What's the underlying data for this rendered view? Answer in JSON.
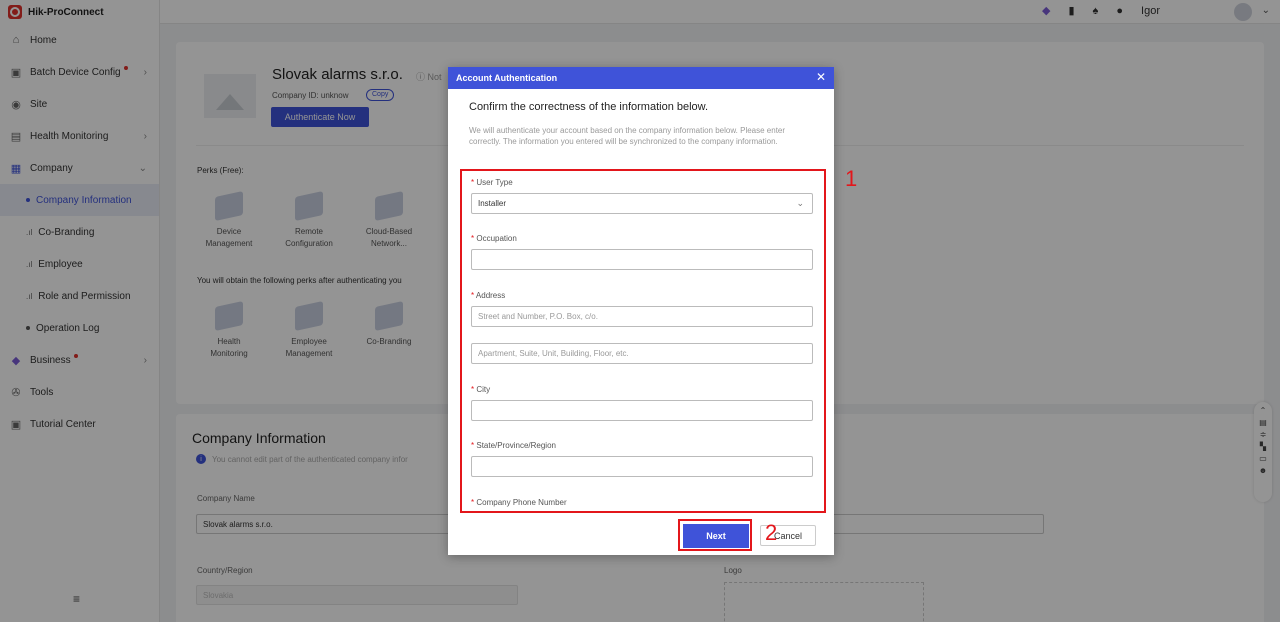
{
  "app": {
    "brand": "Hik-ProConnect"
  },
  "sidebar": {
    "items": [
      {
        "label": "Home"
      },
      {
        "label": "Batch Device Config"
      },
      {
        "label": "Site"
      },
      {
        "label": "Health Monitoring"
      },
      {
        "label": "Company"
      }
    ],
    "company_sub": [
      {
        "label": "Company Information"
      },
      {
        "label": "Co-Branding"
      },
      {
        "label": "Employee"
      },
      {
        "label": "Role and Permission"
      },
      {
        "label": "Operation Log"
      }
    ],
    "bottom_items": [
      {
        "label": "Business"
      },
      {
        "label": "Tools"
      },
      {
        "label": "Tutorial Center"
      }
    ],
    "collapse_glyph": "≡"
  },
  "topbar": {
    "user": "Igor"
  },
  "company_card": {
    "name": "Slovak alarms s.r.o.",
    "not_label": "Not",
    "company_id": "Company ID: unknow",
    "copy_label": "Copy",
    "auth_button": "Authenticate Now",
    "perks_title": "Perks (Free):",
    "perks": [
      {
        "line1": "Device",
        "line2": "Management"
      },
      {
        "line1": "Remote",
        "line2": "Configuration"
      },
      {
        "line1": "Cloud-Based",
        "line2": "Network..."
      }
    ],
    "obtain_title": "You will obtain the following perks after authenticating you",
    "obtain_perks": [
      {
        "line1": "Health",
        "line2": "Monitoring"
      },
      {
        "line1": "Employee",
        "line2": "Management"
      },
      {
        "line1": "Co-Branding",
        "line2": ""
      }
    ]
  },
  "info_card": {
    "title": "Company Information",
    "note": "You cannot edit part of the authenticated company infor",
    "company_name_label": "Company Name",
    "company_name_value": "Slovak alarms s.r.o.",
    "country_label": "Country/Region",
    "country_value": "Slovakia",
    "logo_label": "Logo"
  },
  "modal": {
    "title": "Account Authentication",
    "subtitle": "Confirm the correctness of the information below.",
    "description": "We will authenticate your account based on the company information below. Please enter correctly. The information you entered will be synchronized to the company information.",
    "fields": {
      "user_type_label": "User Type",
      "user_type_value": "Installer",
      "occupation_label": "Occupation",
      "address_label": "Address",
      "address1_placeholder": "Street and Number, P.O. Box, c/o.",
      "address2_placeholder": "Apartment, Suite, Unit, Building, Floor, etc.",
      "city_label": "City",
      "state_label": "State/Province/Region",
      "phone_label": "Company Phone Number"
    },
    "required_mark": "*",
    "next_button": "Next",
    "cancel_button": "Cancel"
  },
  "annotations": {
    "one": "1",
    "two": "2"
  },
  "colors": {
    "primary": "#3f53d9",
    "annotation_red": "#e3161b",
    "badge_red": "#e0312b"
  }
}
